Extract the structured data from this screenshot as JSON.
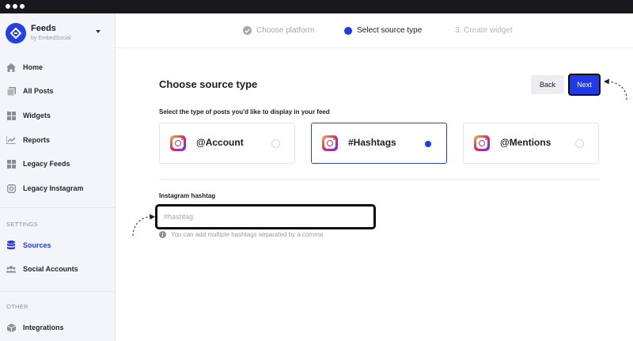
{
  "sidebar": {
    "brand_title": "Feeds",
    "brand_subtitle": "by EmbedSocial",
    "items": [
      {
        "label": "Home",
        "icon": "home-icon"
      },
      {
        "label": "All Posts",
        "icon": "posts-icon"
      },
      {
        "label": "Widgets",
        "icon": "widgets-icon"
      },
      {
        "label": "Reports",
        "icon": "reports-icon"
      },
      {
        "label": "Legacy Feeds",
        "icon": "legacy-feeds-icon"
      },
      {
        "label": "Legacy Instagram",
        "icon": "instagram-outline-icon"
      }
    ],
    "settings_section": "SETTINGS",
    "settings_items": [
      {
        "label": "Sources",
        "icon": "database-icon",
        "active": true
      },
      {
        "label": "Social Accounts",
        "icon": "users-icon"
      }
    ],
    "other_section": "OTHER",
    "other_items": [
      {
        "label": "Integrations",
        "icon": "integrations-icon"
      }
    ]
  },
  "stepper": {
    "steps": [
      {
        "label": "Choose platform",
        "state": "done"
      },
      {
        "label": "Select source type",
        "state": "current"
      },
      {
        "label": "3. Create widget",
        "state": "upcoming"
      }
    ]
  },
  "main": {
    "title": "Choose source type",
    "back_label": "Back",
    "next_label": "Next",
    "subtitle": "Select the type of posts you'd like to display in your feed",
    "options": [
      {
        "label": "@Account",
        "selected": false
      },
      {
        "label": "#Hashtags",
        "selected": true
      },
      {
        "label": "@Mentions",
        "selected": false
      }
    ],
    "field_label": "Instagram hashtag",
    "field_placeholder": "#hashtag",
    "field_value": "",
    "hint": "You can add multiple hashtags separated by a comma"
  },
  "colors": {
    "accent": "#1f3ae6",
    "sidebar_bg": "#f4f5f9",
    "chrome": "#17171c"
  }
}
